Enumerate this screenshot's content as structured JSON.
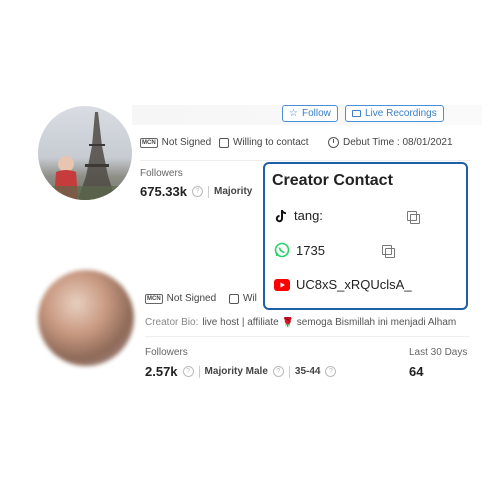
{
  "creator1": {
    "follow_label": "Follow",
    "live_label": "Live Recordings",
    "mcn_badge": "MCN",
    "mcn_status": "Not Signed",
    "contact_status": "Willing to contact",
    "debut_label": "Debut Time : 08/01/2021",
    "followers_label": "Followers",
    "followers_value": "675.33k",
    "audience": "Majority"
  },
  "creator2": {
    "mcn_badge": "MCN",
    "mcn_status": "Not Signed",
    "contact_status_partial": "Wil",
    "bio_label": "Creator Bio:",
    "bio_text": "live host | affiliate 🌹 semoga Bismillah ini menjadi Alham",
    "followers_label": "Followers",
    "followers_value": "2.57k",
    "audience": "Majority Male",
    "age_range": "35-44",
    "last30_label": "Last 30 Days",
    "last30_value": "64"
  },
  "popup": {
    "title": "Creator Contact",
    "tiktok_value": "tang:",
    "whatsapp_value": "1735",
    "youtube_value": "UC8xS_xRQUclsA_"
  },
  "colors": {
    "accent": "#3a7fc8",
    "popup_border": "#1f5fa8",
    "whatsapp": "#25d366",
    "youtube": "#ff0000"
  }
}
